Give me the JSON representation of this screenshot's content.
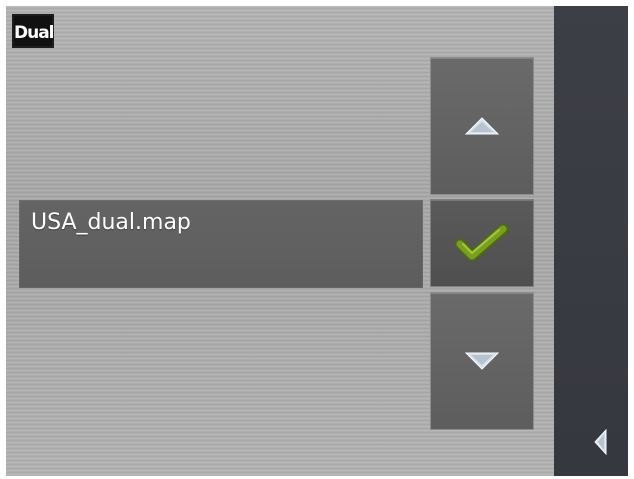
{
  "app": {
    "logo_text": "Dual"
  },
  "list": {
    "items": [
      {
        "label": "USA_dual.map",
        "selected": true
      }
    ]
  },
  "controls": {
    "up_icon": "triangle-up-icon",
    "confirm_icon": "checkmark-icon",
    "down_icon": "triangle-down-icon",
    "back_icon": "triangle-left-icon"
  },
  "colors": {
    "confirm": "#7aa019",
    "arrow": "#d8e1ea",
    "panel": "#3a3c43"
  }
}
